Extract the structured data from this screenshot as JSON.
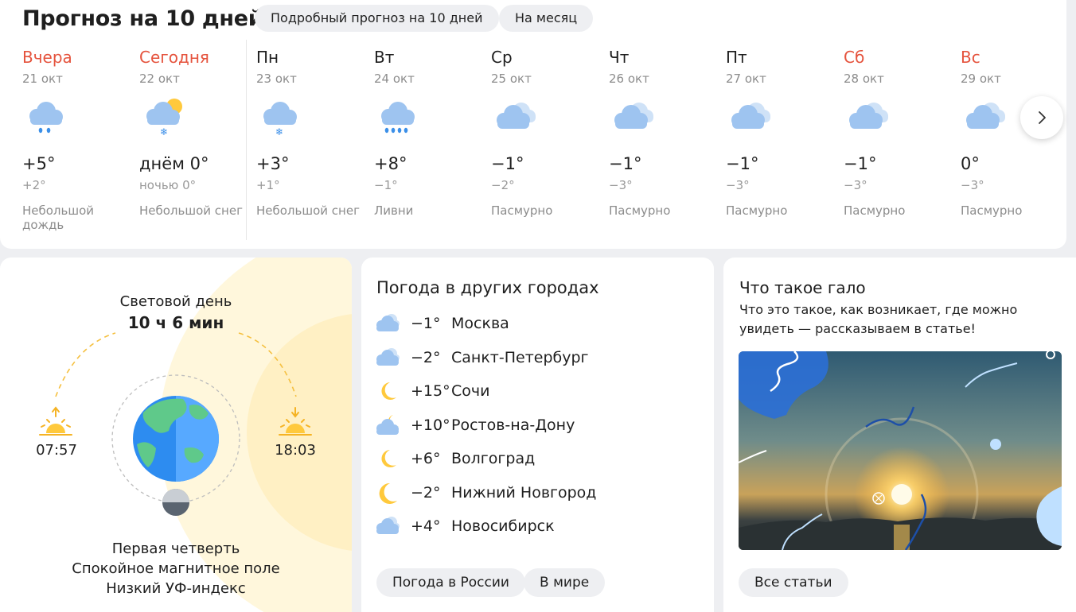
{
  "forecast": {
    "title": "Прогноз на 10 дней",
    "detailed_label": "Подробный прогноз на 10 дней",
    "month_label": "На месяц",
    "days": [
      {
        "name": "Вчера",
        "date": "21 окт",
        "temp": "+5°",
        "night": "+2°",
        "condition": "Небольшой дождь",
        "icon": "cloud-rain-icon"
      },
      {
        "name": "Сегодня",
        "date": "22 окт",
        "temp": "днём 0°",
        "night": "ночью 0°",
        "condition": "Небольшой снег",
        "icon": "sun-cloud-snow-icon"
      },
      {
        "name": "Пн",
        "date": "23 окт",
        "temp": "+3°",
        "night": "+1°",
        "condition": "Небольшой снег",
        "icon": "cloud-snow-icon"
      },
      {
        "name": "Вт",
        "date": "24 окт",
        "temp": "+8°",
        "night": "−1°",
        "condition": "Ливни",
        "icon": "cloud-heavy-rain-icon"
      },
      {
        "name": "Ср",
        "date": "25 окт",
        "temp": "−1°",
        "night": "−2°",
        "condition": "Пасмурно",
        "icon": "overcast-icon"
      },
      {
        "name": "Чт",
        "date": "26 окт",
        "temp": "−1°",
        "night": "−3°",
        "condition": "Пасмурно",
        "icon": "overcast-icon"
      },
      {
        "name": "Пт",
        "date": "27 окт",
        "temp": "−1°",
        "night": "−3°",
        "condition": "Пасмурно",
        "icon": "overcast-icon"
      },
      {
        "name": "Сб",
        "date": "28 окт",
        "temp": "−1°",
        "night": "−3°",
        "condition": "Пасмурно",
        "icon": "overcast-icon"
      },
      {
        "name": "Вс",
        "date": "29 окт",
        "temp": "0°",
        "night": "−3°",
        "condition": "Пасмурно",
        "icon": "overcast-icon"
      }
    ]
  },
  "sun": {
    "daylight_label": "Световой день",
    "daylight_value": "10 ч 6 мин",
    "sunrise": "07:57",
    "sunset": "18:03",
    "moon_phase": "Первая четверть",
    "magnetic": "Спокойное магнитное поле",
    "uv": "Низкий УФ-индекс"
  },
  "cities": {
    "title": "Погода в других городах",
    "items": [
      {
        "temp": "−1°",
        "name": "Москва",
        "icon": "overcast-icon"
      },
      {
        "temp": "−2°",
        "name": "Санкт-Петербург",
        "icon": "overcast-icon"
      },
      {
        "temp": "+15°",
        "name": "Сочи",
        "icon": "moon-icon"
      },
      {
        "temp": "+10°",
        "name": "Ростов-на-Дону",
        "icon": "moon-cloud-icon"
      },
      {
        "temp": "+6°",
        "name": "Волгоград",
        "icon": "moon-icon"
      },
      {
        "temp": "−2°",
        "name": "Нижний Новгород",
        "icon": "moon-icon"
      },
      {
        "temp": "+4°",
        "name": "Новосибирск",
        "icon": "overcast-icon"
      }
    ],
    "russia_label": "Погода в России",
    "world_label": "В мире"
  },
  "article": {
    "title": "Что такое гало",
    "description": "Что это такое, как возникает, где можно увидеть — рассказываем в статье!",
    "all_label": "Все статьи"
  },
  "colors": {
    "weekend": "#e5533d",
    "cloud": "#9ec4f0",
    "sun": "#ffc93c"
  }
}
